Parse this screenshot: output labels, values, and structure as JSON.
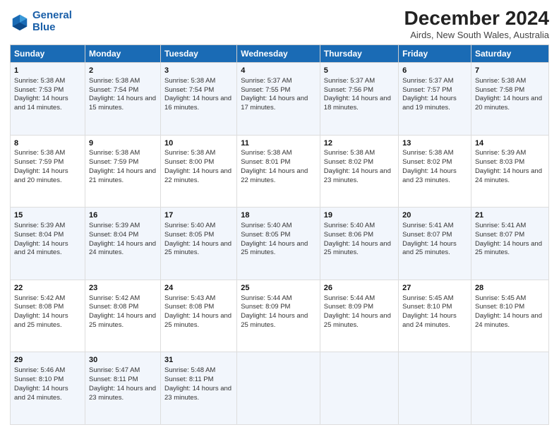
{
  "header": {
    "logo_line1": "General",
    "logo_line2": "Blue",
    "title": "December 2024",
    "subtitle": "Airds, New South Wales, Australia"
  },
  "days_of_week": [
    "Sunday",
    "Monday",
    "Tuesday",
    "Wednesday",
    "Thursday",
    "Friday",
    "Saturday"
  ],
  "weeks": [
    [
      {
        "day": "1",
        "rise": "Sunrise: 5:38 AM",
        "set": "Sunset: 7:53 PM",
        "day_text": "Daylight: 14 hours and 14 minutes."
      },
      {
        "day": "2",
        "rise": "Sunrise: 5:38 AM",
        "set": "Sunset: 7:54 PM",
        "day_text": "Daylight: 14 hours and 15 minutes."
      },
      {
        "day": "3",
        "rise": "Sunrise: 5:38 AM",
        "set": "Sunset: 7:54 PM",
        "day_text": "Daylight: 14 hours and 16 minutes."
      },
      {
        "day": "4",
        "rise": "Sunrise: 5:37 AM",
        "set": "Sunset: 7:55 PM",
        "day_text": "Daylight: 14 hours and 17 minutes."
      },
      {
        "day": "5",
        "rise": "Sunrise: 5:37 AM",
        "set": "Sunset: 7:56 PM",
        "day_text": "Daylight: 14 hours and 18 minutes."
      },
      {
        "day": "6",
        "rise": "Sunrise: 5:37 AM",
        "set": "Sunset: 7:57 PM",
        "day_text": "Daylight: 14 hours and 19 minutes."
      },
      {
        "day": "7",
        "rise": "Sunrise: 5:38 AM",
        "set": "Sunset: 7:58 PM",
        "day_text": "Daylight: 14 hours and 20 minutes."
      }
    ],
    [
      {
        "day": "8",
        "rise": "Sunrise: 5:38 AM",
        "set": "Sunset: 7:59 PM",
        "day_text": "Daylight: 14 hours and 20 minutes."
      },
      {
        "day": "9",
        "rise": "Sunrise: 5:38 AM",
        "set": "Sunset: 7:59 PM",
        "day_text": "Daylight: 14 hours and 21 minutes."
      },
      {
        "day": "10",
        "rise": "Sunrise: 5:38 AM",
        "set": "Sunset: 8:00 PM",
        "day_text": "Daylight: 14 hours and 22 minutes."
      },
      {
        "day": "11",
        "rise": "Sunrise: 5:38 AM",
        "set": "Sunset: 8:01 PM",
        "day_text": "Daylight: 14 hours and 22 minutes."
      },
      {
        "day": "12",
        "rise": "Sunrise: 5:38 AM",
        "set": "Sunset: 8:02 PM",
        "day_text": "Daylight: 14 hours and 23 minutes."
      },
      {
        "day": "13",
        "rise": "Sunrise: 5:38 AM",
        "set": "Sunset: 8:02 PM",
        "day_text": "Daylight: 14 hours and 23 minutes."
      },
      {
        "day": "14",
        "rise": "Sunrise: 5:39 AM",
        "set": "Sunset: 8:03 PM",
        "day_text": "Daylight: 14 hours and 24 minutes."
      }
    ],
    [
      {
        "day": "15",
        "rise": "Sunrise: 5:39 AM",
        "set": "Sunset: 8:04 PM",
        "day_text": "Daylight: 14 hours and 24 minutes."
      },
      {
        "day": "16",
        "rise": "Sunrise: 5:39 AM",
        "set": "Sunset: 8:04 PM",
        "day_text": "Daylight: 14 hours and 24 minutes."
      },
      {
        "day": "17",
        "rise": "Sunrise: 5:40 AM",
        "set": "Sunset: 8:05 PM",
        "day_text": "Daylight: 14 hours and 25 minutes."
      },
      {
        "day": "18",
        "rise": "Sunrise: 5:40 AM",
        "set": "Sunset: 8:05 PM",
        "day_text": "Daylight: 14 hours and 25 minutes."
      },
      {
        "day": "19",
        "rise": "Sunrise: 5:40 AM",
        "set": "Sunset: 8:06 PM",
        "day_text": "Daylight: 14 hours and 25 minutes."
      },
      {
        "day": "20",
        "rise": "Sunrise: 5:41 AM",
        "set": "Sunset: 8:07 PM",
        "day_text": "Daylight: 14 hours and 25 minutes."
      },
      {
        "day": "21",
        "rise": "Sunrise: 5:41 AM",
        "set": "Sunset: 8:07 PM",
        "day_text": "Daylight: 14 hours and 25 minutes."
      }
    ],
    [
      {
        "day": "22",
        "rise": "Sunrise: 5:42 AM",
        "set": "Sunset: 8:08 PM",
        "day_text": "Daylight: 14 hours and 25 minutes."
      },
      {
        "day": "23",
        "rise": "Sunrise: 5:42 AM",
        "set": "Sunset: 8:08 PM",
        "day_text": "Daylight: 14 hours and 25 minutes."
      },
      {
        "day": "24",
        "rise": "Sunrise: 5:43 AM",
        "set": "Sunset: 8:08 PM",
        "day_text": "Daylight: 14 hours and 25 minutes."
      },
      {
        "day": "25",
        "rise": "Sunrise: 5:44 AM",
        "set": "Sunset: 8:09 PM",
        "day_text": "Daylight: 14 hours and 25 minutes."
      },
      {
        "day": "26",
        "rise": "Sunrise: 5:44 AM",
        "set": "Sunset: 8:09 PM",
        "day_text": "Daylight: 14 hours and 25 minutes."
      },
      {
        "day": "27",
        "rise": "Sunrise: 5:45 AM",
        "set": "Sunset: 8:10 PM",
        "day_text": "Daylight: 14 hours and 24 minutes."
      },
      {
        "day": "28",
        "rise": "Sunrise: 5:45 AM",
        "set": "Sunset: 8:10 PM",
        "day_text": "Daylight: 14 hours and 24 minutes."
      }
    ],
    [
      {
        "day": "29",
        "rise": "Sunrise: 5:46 AM",
        "set": "Sunset: 8:10 PM",
        "day_text": "Daylight: 14 hours and 24 minutes."
      },
      {
        "day": "30",
        "rise": "Sunrise: 5:47 AM",
        "set": "Sunset: 8:11 PM",
        "day_text": "Daylight: 14 hours and 23 minutes."
      },
      {
        "day": "31",
        "rise": "Sunrise: 5:48 AM",
        "set": "Sunset: 8:11 PM",
        "day_text": "Daylight: 14 hours and 23 minutes."
      },
      {
        "day": "",
        "rise": "",
        "set": "",
        "day_text": ""
      },
      {
        "day": "",
        "rise": "",
        "set": "",
        "day_text": ""
      },
      {
        "day": "",
        "rise": "",
        "set": "",
        "day_text": ""
      },
      {
        "day": "",
        "rise": "",
        "set": "",
        "day_text": ""
      }
    ]
  ]
}
